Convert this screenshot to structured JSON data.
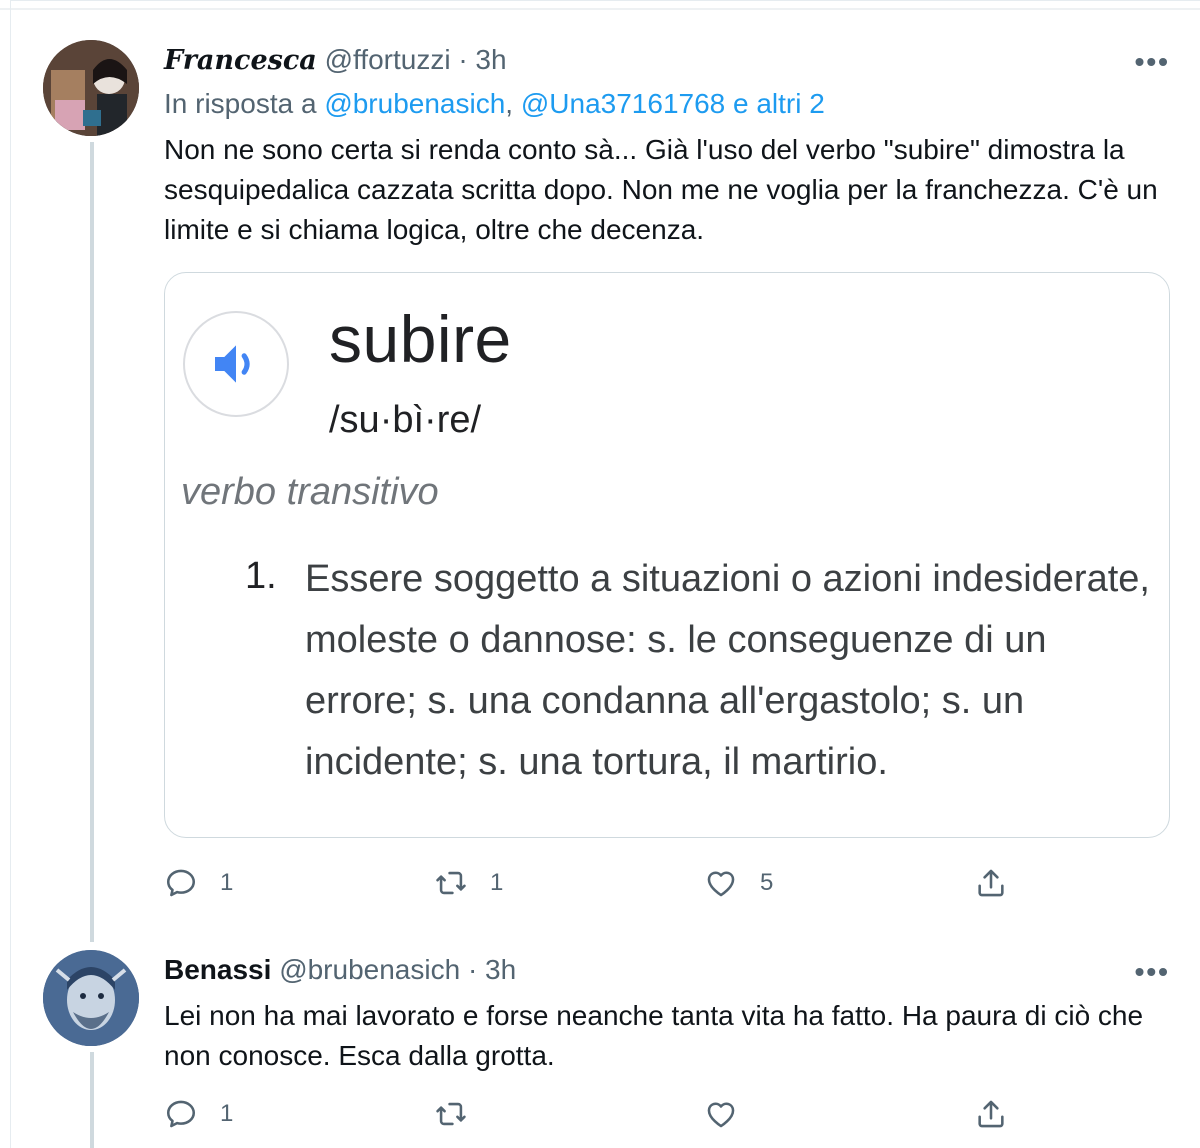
{
  "tweets": [
    {
      "author": "Francesca",
      "handle": "@ffortuzzi",
      "time": "· 3h",
      "more": "•••",
      "reply_prefix": "In risposta a ",
      "reply_mentions": "@brubenasich",
      "reply_sep": ", ",
      "reply_mentions2": "@Una37161768 e altri 2",
      "text": "Non ne sono certa si renda conto sà... Già l'uso del verbo \"subire\" dimostra la sesquipedalica cazzata scritta dopo. Non me ne voglia per la franchezza. C'è un limite e si chiama logica, oltre che decenza.",
      "card": {
        "word": "subire",
        "phonetic": "/su·bì·re/",
        "part_of_speech": "verbo transitivo",
        "def_number": "1.",
        "definition": "Essere soggetto a situazioni o azioni indesiderate, moleste o dannose: s. le conseguenze di un errore; s. una condanna all'ergastolo; s. un incidente; s. una tortura, il martirio."
      },
      "actions": {
        "reply_count": "1",
        "retweet_count": "1",
        "like_count": "5"
      }
    },
    {
      "author": "Benassi",
      "handle": "@brubenasich",
      "time": "· 3h",
      "more": "•••",
      "text": "Lei non ha mai lavorato e forse neanche tanta vita ha fatto. Ha paura di ciò che non conosce. Esca dalla grotta.",
      "actions": {
        "reply_count": "1",
        "retweet_count": "",
        "like_count": ""
      }
    }
  ],
  "icons": {
    "reply": "reply-icon",
    "retweet": "retweet-icon",
    "like": "heart-icon",
    "share": "share-icon",
    "speaker": "speaker-icon"
  },
  "colors": {
    "link": "#1d9bf0",
    "secondary": "#536471",
    "speaker": "#4285f4"
  }
}
